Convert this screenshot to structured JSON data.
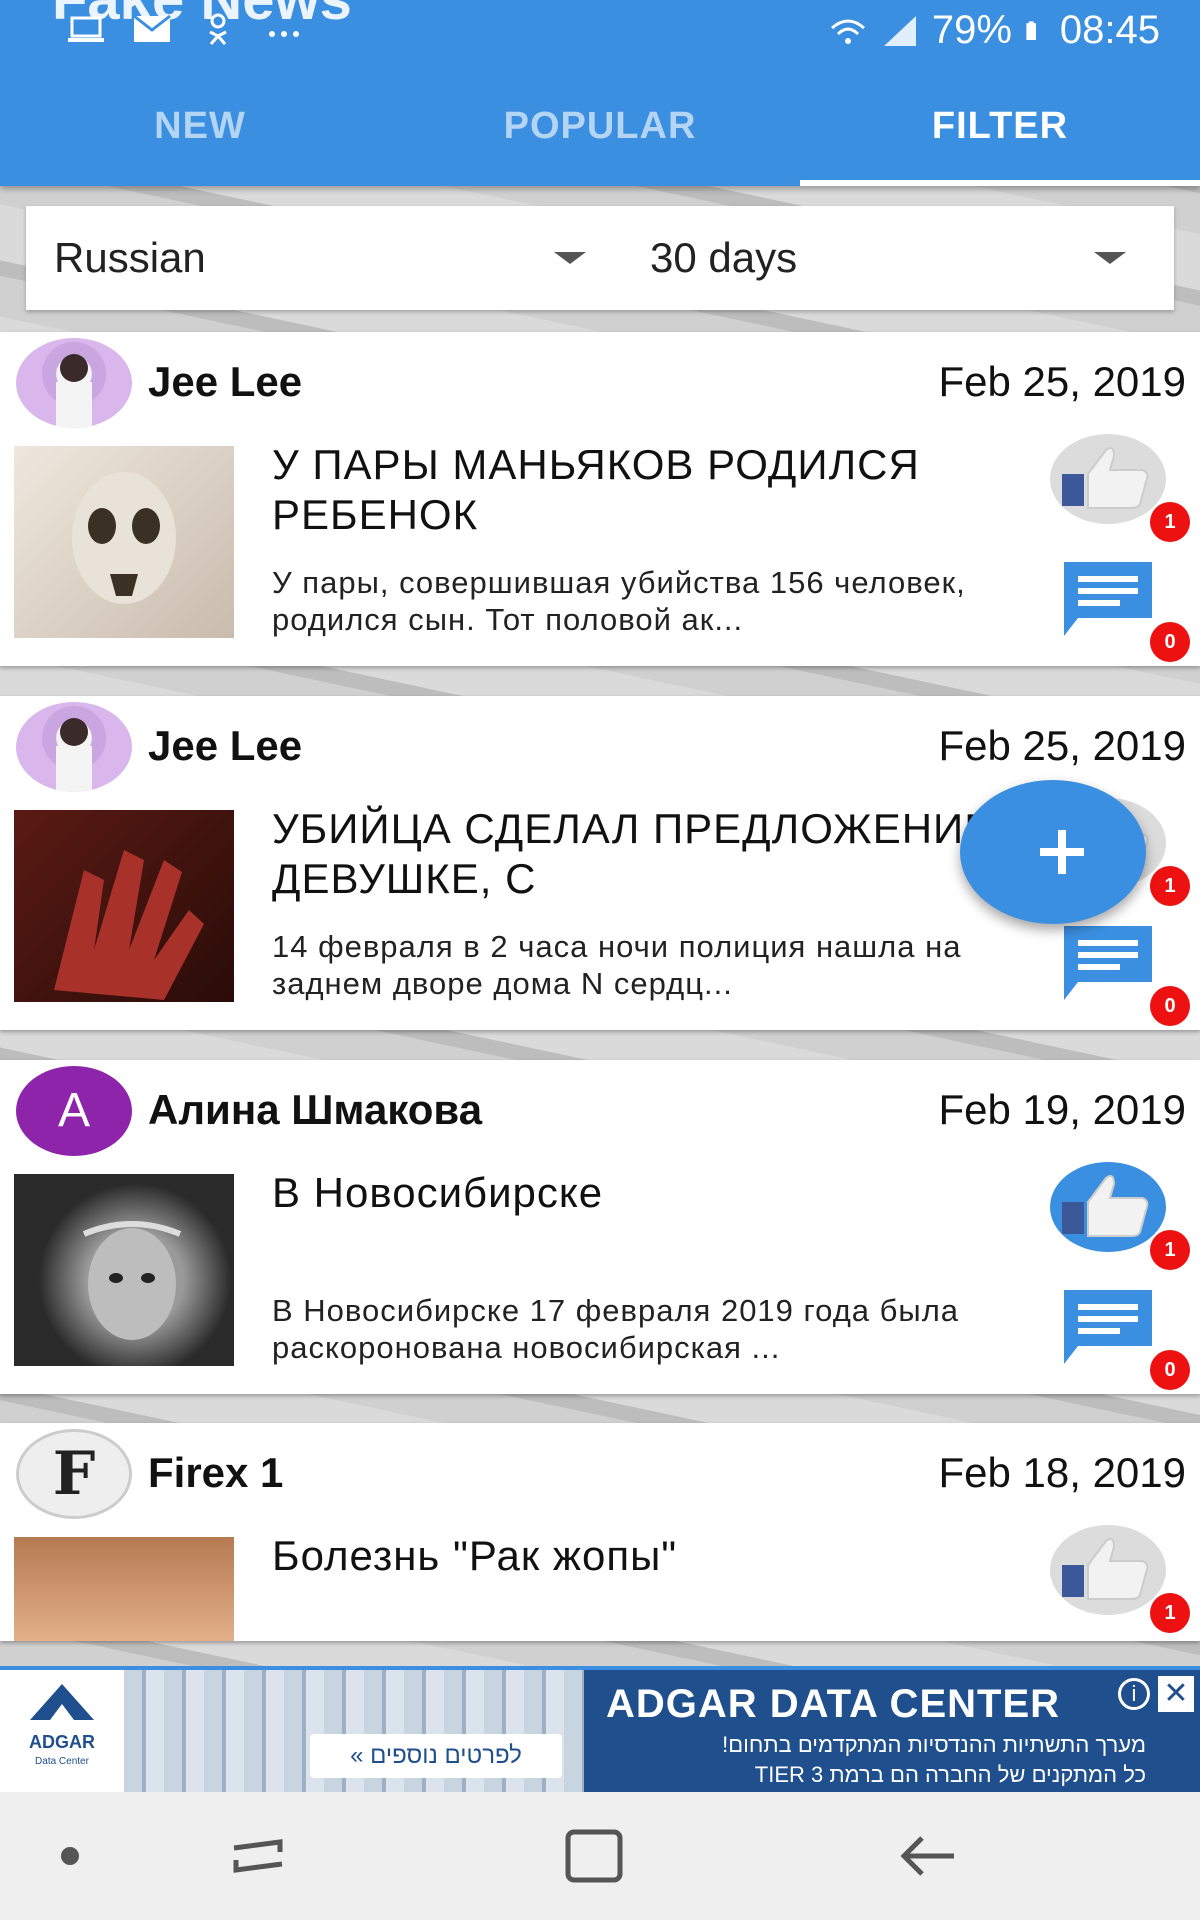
{
  "status_bar": {
    "app_title_peek": "Fake News",
    "battery": "79%",
    "time": "08:45"
  },
  "tabs": [
    {
      "label": "NEW",
      "active": false
    },
    {
      "label": "POPULAR",
      "active": false
    },
    {
      "label": "FILTER",
      "active": true
    }
  ],
  "filters": {
    "language": "Russian",
    "period": "30 days"
  },
  "posts": [
    {
      "author": "Jee Lee",
      "date": "Feb 25, 2019",
      "title": "У ПАРЫ МАНЬЯКОВ РОДИЛСЯ РЕБЕНОК",
      "excerpt": "У пары, совершившая убийства 156 человек, родился сын. Тот половой ак...",
      "likes": "1",
      "comments": "0",
      "liked": false
    },
    {
      "author": "Jee Lee",
      "date": "Feb 25, 2019",
      "title": "УБИЙЦА СДЕЛАЛ ПРЕДЛОЖЕНИЕ ДЕВУШКЕ, С",
      "excerpt": "14 февраля в 2 часа ночи полиция нашла на заднем дворе дома N сердц...",
      "likes": "1",
      "comments": "0",
      "liked": false
    },
    {
      "author": "Алина Шмакова",
      "avatar_letter": "A",
      "date": "Feb 19, 2019",
      "title": "В Новосибирске",
      "excerpt": "В Новосибирске 17 февраля 2019 года была раскоронована новосибирская ...",
      "likes": "1",
      "comments": "0",
      "liked": true
    },
    {
      "author": "Firex 1",
      "avatar_letter": "F",
      "date": "Feb 18, 2019",
      "title": "Болезнь \"Рак жопы\"",
      "likes": "1",
      "liked": false
    }
  ],
  "ad": {
    "logo_text": "ADGAR",
    "logo_sub": "Data Center",
    "title": "ADGAR DATA CENTER",
    "line1": "מערך התשתיות ההנדסיות המתקדמים בתחום!",
    "line2": "כל המתקנים של החברה הם ברמת TIER 3",
    "button": "לפרטים נוספים »"
  },
  "colors": {
    "primary": "#3a8fe0",
    "badge": "#e11111"
  }
}
